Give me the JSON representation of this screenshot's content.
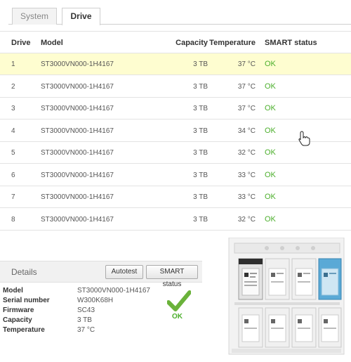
{
  "tabs": [
    {
      "label": "System",
      "active": false
    },
    {
      "label": "Drive",
      "active": true
    }
  ],
  "table": {
    "headers": {
      "drive": "Drive",
      "model": "Model",
      "capacity": "Capacity",
      "temperature": "Temperature",
      "smart": "SMART status"
    },
    "rows": [
      {
        "drive": "1",
        "model": "ST3000VN000-1H4167",
        "capacity": "3 TB",
        "temperature": "37 °C",
        "smart": "OK"
      },
      {
        "drive": "2",
        "model": "ST3000VN000-1H4167",
        "capacity": "3 TB",
        "temperature": "37 °C",
        "smart": "OK"
      },
      {
        "drive": "3",
        "model": "ST3000VN000-1H4167",
        "capacity": "3 TB",
        "temperature": "37 °C",
        "smart": "OK"
      },
      {
        "drive": "4",
        "model": "ST3000VN000-1H4167",
        "capacity": "3 TB",
        "temperature": "34 °C",
        "smart": "OK"
      },
      {
        "drive": "5",
        "model": "ST3000VN000-1H4167",
        "capacity": "3 TB",
        "temperature": "32 °C",
        "smart": "OK"
      },
      {
        "drive": "6",
        "model": "ST3000VN000-1H4167",
        "capacity": "3 TB",
        "temperature": "33 °C",
        "smart": "OK"
      },
      {
        "drive": "7",
        "model": "ST3000VN000-1H4167",
        "capacity": "3 TB",
        "temperature": "33 °C",
        "smart": "OK"
      },
      {
        "drive": "8",
        "model": "ST3000VN000-1H4167",
        "capacity": "3 TB",
        "temperature": "32 °C",
        "smart": "OK"
      }
    ],
    "selected_row": 1
  },
  "details": {
    "title": "Details",
    "autotest_label": "Autotest",
    "smart_label": "SMART status",
    "fields": [
      {
        "key": "Model",
        "value": "ST3000VN000-1H4167"
      },
      {
        "key": "Serial number",
        "value": "W300K68H"
      },
      {
        "key": "Firmware",
        "value": "SC43"
      },
      {
        "key": "Capacity",
        "value": "3 TB"
      },
      {
        "key": "Temperature",
        "value": "37 °C"
      }
    ],
    "status_text": "OK"
  },
  "colors": {
    "ok_green": "#4caf2c",
    "selected_row": "#fefdd0",
    "highlight_bay": "#5aa9d6"
  },
  "icons": {
    "ok": "check-mark-icon",
    "cursor": "hand-pointer-icon"
  }
}
